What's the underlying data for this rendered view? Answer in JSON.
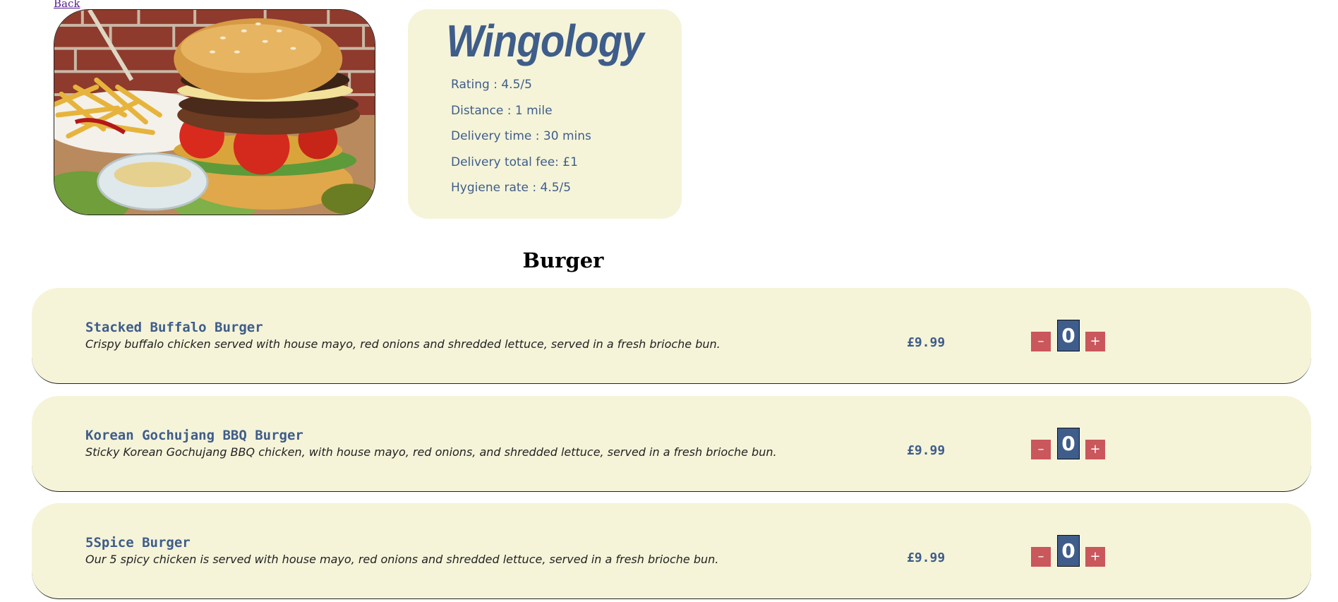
{
  "nav": {
    "back_label": "Back"
  },
  "restaurant": {
    "name": "Wingology",
    "photo_icon": "burger-photo",
    "details": [
      "Rating : 4.5/5",
      "Distance : 1 mile",
      "Delivery time : 30 mins",
      "Delivery total fee: £1",
      "Hygiene rate : 4.5/5"
    ]
  },
  "section": {
    "title": "Burger"
  },
  "items": [
    {
      "name": "Stacked Buffalo Burger",
      "description": "Crispy buffalo chicken served with house mayo, red onions and shredded lettuce, served in a fresh brioche bun.",
      "price": "£9.99",
      "quantity": "0"
    },
    {
      "name": "Korean Gochujang BBQ Burger",
      "description": "Sticky Korean Gochujang BBQ chicken, with house mayo, red onions, and shredded lettuce, served in a fresh brioche bun.",
      "price": "£9.99",
      "quantity": "0"
    },
    {
      "name": "5Spice Burger",
      "description": "Our 5 spicy chicken is served with house mayo, red onions and shredded lettuce, served in a fresh brioche bun.",
      "price": "£9.99",
      "quantity": "0"
    }
  ],
  "controls": {
    "minus_label": "–",
    "plus_label": "+"
  },
  "colors": {
    "card_bg": "#f5f4d9",
    "accent_blue": "#3f5d8a",
    "button_red": "#c9575c"
  }
}
